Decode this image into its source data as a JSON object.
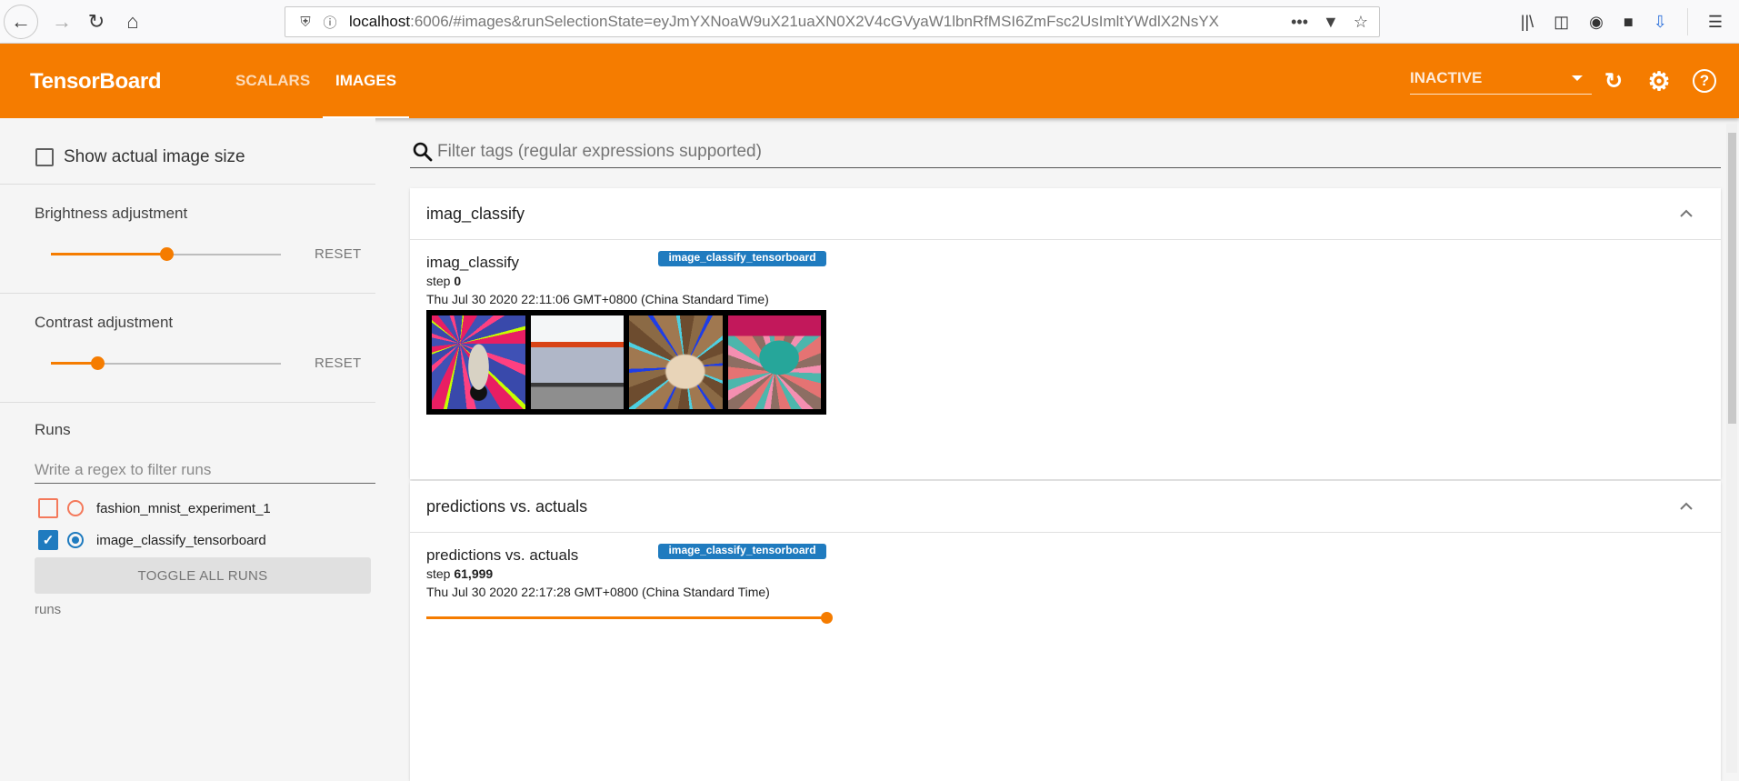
{
  "browser": {
    "url_host": "localhost",
    "url_rest": ":6006/#images&runSelectionState=eyJmYXNoaW9uX21uaXN0X2V4cGVyaW1lbnRfMSI6ZmFsc2UsImltYWdlX2NsYX",
    "icons": [
      "back-icon",
      "forward-icon",
      "reload-icon",
      "home-icon",
      "shield-icon",
      "info-icon",
      "more-icon",
      "pocket-icon",
      "bookmark-star-icon",
      "library-icon",
      "sidebar-icon",
      "account-icon",
      "extension-icon",
      "download-extension-icon",
      "menu-icon"
    ]
  },
  "header": {
    "brand": "TensorBoard",
    "tabs": [
      {
        "label": "SCALARS",
        "active": false
      },
      {
        "label": "IMAGES",
        "active": true
      }
    ],
    "reload_mode": "INACTIVE",
    "accent": "#f57c00"
  },
  "sidebar": {
    "show_actual_size": {
      "label": "Show actual image size",
      "checked": false
    },
    "brightness": {
      "label": "Brightness adjustment",
      "value_fraction": 0.5,
      "reset_label": "RESET"
    },
    "contrast": {
      "label": "Contrast adjustment",
      "value_fraction": 0.2,
      "reset_label": "RESET"
    },
    "runs": {
      "title": "Runs",
      "filter_placeholder": "Write a regex to filter runs",
      "items": [
        {
          "name": "fashion_mnist_experiment_1",
          "checked": false,
          "color": "#f4795b",
          "selected": false
        },
        {
          "name": "image_classify_tensorboard",
          "checked": true,
          "color": "#1f7bbf",
          "selected": true
        }
      ],
      "toggle_all_label": "TOGGLE ALL RUNS",
      "footer": "runs"
    }
  },
  "main": {
    "filter_placeholder": "Filter tags (regular expressions supported)",
    "panes": [
      {
        "title": "imag_classify",
        "card": {
          "title": "imag_classify",
          "run": "image_classify_tensorboard",
          "step_label": "step",
          "step": "0",
          "time": "Thu Jul 30 2020 22:11:06 GMT+0800 (China Standard Time)",
          "image_count": 4
        }
      },
      {
        "title": "predictions vs. actuals",
        "card": {
          "title": "predictions vs. actuals",
          "run": "image_classify_tensorboard",
          "step_label": "step",
          "step": "61,999",
          "time": "Thu Jul 30 2020 22:17:28 GMT+0800 (China Standard Time)",
          "step_slider_fraction": 1.0
        }
      }
    ]
  }
}
